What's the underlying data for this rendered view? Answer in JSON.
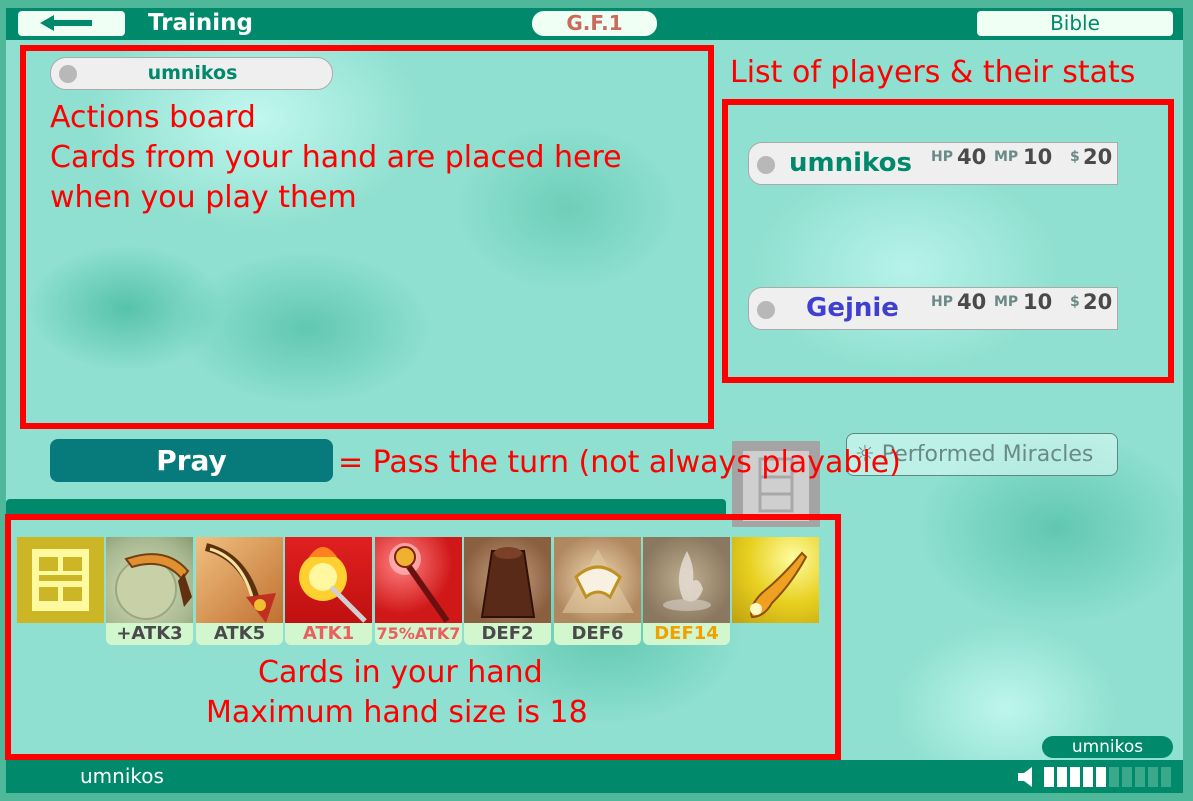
{
  "header": {
    "title": "Training",
    "game_id": "G.F.1",
    "bible_label": "Bible"
  },
  "actions_board": {
    "player_name": "umnikos",
    "annotation_lines": [
      "Actions board",
      "Cards from your hand are placed here",
      "when you play them"
    ]
  },
  "players_panel": {
    "annotation": "List of players & their stats",
    "players": [
      {
        "name": "umnikos",
        "hp_label": "HP",
        "hp": "40",
        "mp_label": "MP",
        "mp": "10",
        "money_label": "$",
        "money": "20",
        "color": "#00896a"
      },
      {
        "name": "Gejnie",
        "hp_label": "HP",
        "hp": "40",
        "mp_label": "MP",
        "mp": "10",
        "money_label": "$",
        "money": "20",
        "color": "#4040d0"
      }
    ]
  },
  "pray": {
    "label": "Pray",
    "annotation": "= Pass the turn (not always playable)"
  },
  "miracles": {
    "label": "☼ Performed Miracles"
  },
  "hand": {
    "annotation_lines": [
      "Cards in your hand",
      "Maximum hand size is 18"
    ],
    "cards": [
      {
        "label": "",
        "icon": "deck-toggle-icon"
      },
      {
        "label": "+ATK3",
        "icon": "boomerang-icon",
        "color": "#4a4a4a"
      },
      {
        "label": "ATK5",
        "icon": "claw-sword-icon",
        "color": "#4a4a4a"
      },
      {
        "label": "ATK1",
        "icon": "torch-icon",
        "color": "#e86060"
      },
      {
        "label": "75%ATK7",
        "icon": "magic-staff-icon",
        "color": "#e86060"
      },
      {
        "label": "DEF2",
        "icon": "cloak-icon",
        "color": "#4a4a4a"
      },
      {
        "label": "DEF6",
        "icon": "winged-boots-icon",
        "color": "#4a4a4a"
      },
      {
        "label": "DEF14",
        "icon": "spirit-flame-icon",
        "color": "#f0a000"
      },
      {
        "label": "",
        "icon": "golden-horn-icon"
      }
    ]
  },
  "footer": {
    "username": "umnikos",
    "user_badge": "umnikos",
    "volume_level": 0.5
  }
}
